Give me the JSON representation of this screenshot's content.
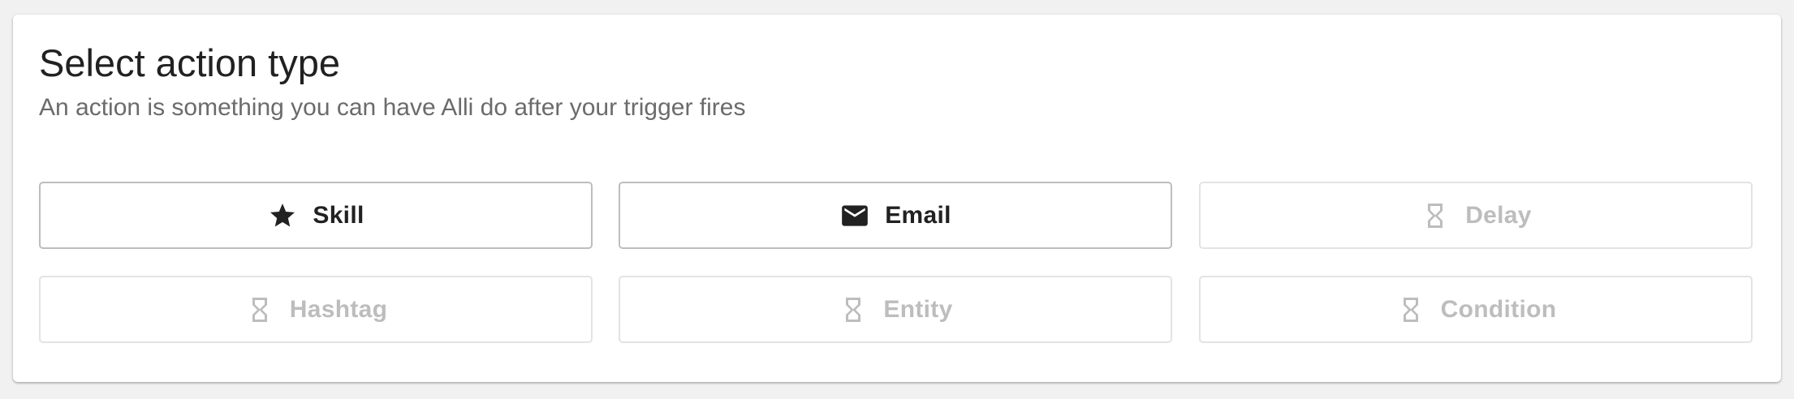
{
  "header": {
    "title": "Select action type",
    "subtitle": "An action is something you can have Alli do after your trigger fires"
  },
  "actions": [
    {
      "label": "Skill",
      "icon": "star-icon",
      "enabled": true
    },
    {
      "label": "Email",
      "icon": "envelope-icon",
      "enabled": true
    },
    {
      "label": "Delay",
      "icon": "hourglass-icon",
      "enabled": false
    },
    {
      "label": "Hashtag",
      "icon": "hourglass-icon",
      "enabled": false
    },
    {
      "label": "Entity",
      "icon": "hourglass-icon",
      "enabled": false
    },
    {
      "label": "Condition",
      "icon": "hourglass-icon",
      "enabled": false
    }
  ],
  "colors": {
    "enabled_text": "#212121",
    "disabled_text": "#bdbdbd",
    "enabled_border": "#bdbdbd",
    "disabled_border": "#e3e3e3"
  }
}
